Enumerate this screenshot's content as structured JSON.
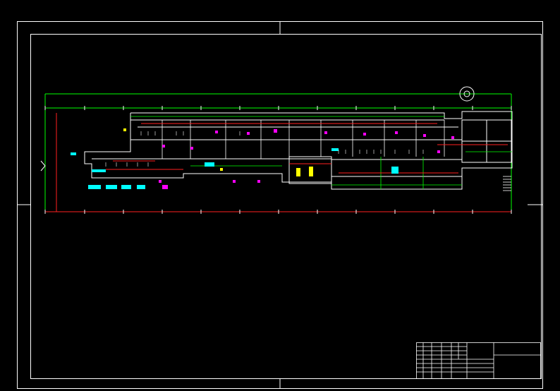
{
  "drawing": {
    "background_color": "#000000",
    "frame_color": "#ffffff",
    "dimension_color": "#00ff00",
    "red_line_color": "#ff2020",
    "title_block": {
      "line1": "",
      "line2": ""
    }
  }
}
